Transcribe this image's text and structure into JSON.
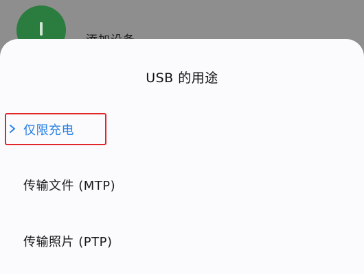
{
  "background": {
    "item_label": "添加设备"
  },
  "sheet": {
    "title": "USB 的用途",
    "options": [
      {
        "label": "仅限充电",
        "selected": true
      },
      {
        "label": "传输文件 (MTP)",
        "selected": false
      },
      {
        "label": "传输照片 (PTP)",
        "selected": false
      }
    ]
  },
  "colors": {
    "selected_text": "#2a82e4",
    "highlight_border": "#e0262a",
    "sheet_bg": "#fbfbfd",
    "scrim": "#8e8e8e"
  }
}
